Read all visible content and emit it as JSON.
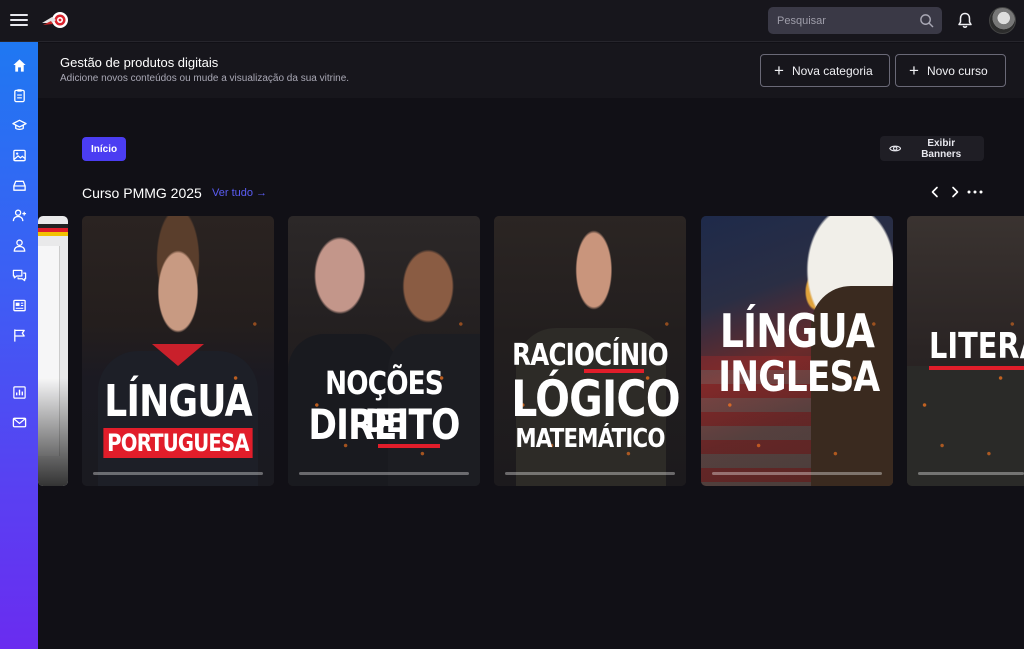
{
  "topbar": {
    "search_placeholder": "Pesquisar",
    "icons": [
      "menu-icon",
      "logo",
      "search-icon",
      "bell-icon",
      "avatar"
    ]
  },
  "sidebar": {
    "items": [
      {
        "name": "home",
        "icon": "home-icon"
      },
      {
        "name": "clipboard",
        "icon": "clipboard-icon"
      },
      {
        "name": "courses",
        "icon": "graduation-cap-icon"
      },
      {
        "name": "images",
        "icon": "image-icon"
      },
      {
        "name": "inbox",
        "icon": "inbox-icon"
      },
      {
        "name": "add-user",
        "icon": "user-plus-icon"
      },
      {
        "name": "users",
        "icon": "users-icon"
      },
      {
        "name": "comments",
        "icon": "chat-icon"
      },
      {
        "name": "news",
        "icon": "newspaper-icon"
      },
      {
        "name": "flag",
        "icon": "flag-icon"
      },
      {
        "name": "reports",
        "icon": "bar-chart-icon"
      },
      {
        "name": "mail",
        "icon": "mail-icon"
      }
    ]
  },
  "header": {
    "title": "Gestão de produtos digitais",
    "subtitle": "Adicione novos conteúdos ou mude a visualização da sua vitrine.",
    "new_category_label": "Nova categoria",
    "new_course_label": "Novo curso"
  },
  "main": {
    "chip_label": "Início",
    "banners_label": "Exibir Banners",
    "section_title": "Curso PMMG 2025",
    "see_all_label": "Ver tudo →",
    "cards": [
      {
        "line1": "LÍNGUA",
        "line2": "PORTUGUESA",
        "progress": 0
      },
      {
        "line1": "NOÇÕES DE",
        "line2": "DIREITO",
        "progress": 0
      },
      {
        "line1": "RACIOCÍNIO",
        "line2": "LÓGICO",
        "line3": "MATEMÁTICO",
        "progress": 0
      },
      {
        "line1": "LÍNGUA",
        "line2": "INGLESA",
        "progress": 0
      },
      {
        "line1": "LITERAT",
        "progress": 0
      }
    ]
  },
  "colors": {
    "accent": "#4b3df2",
    "link": "#5b5df4",
    "brand_red": "#e11d2a",
    "background": "#111016"
  }
}
